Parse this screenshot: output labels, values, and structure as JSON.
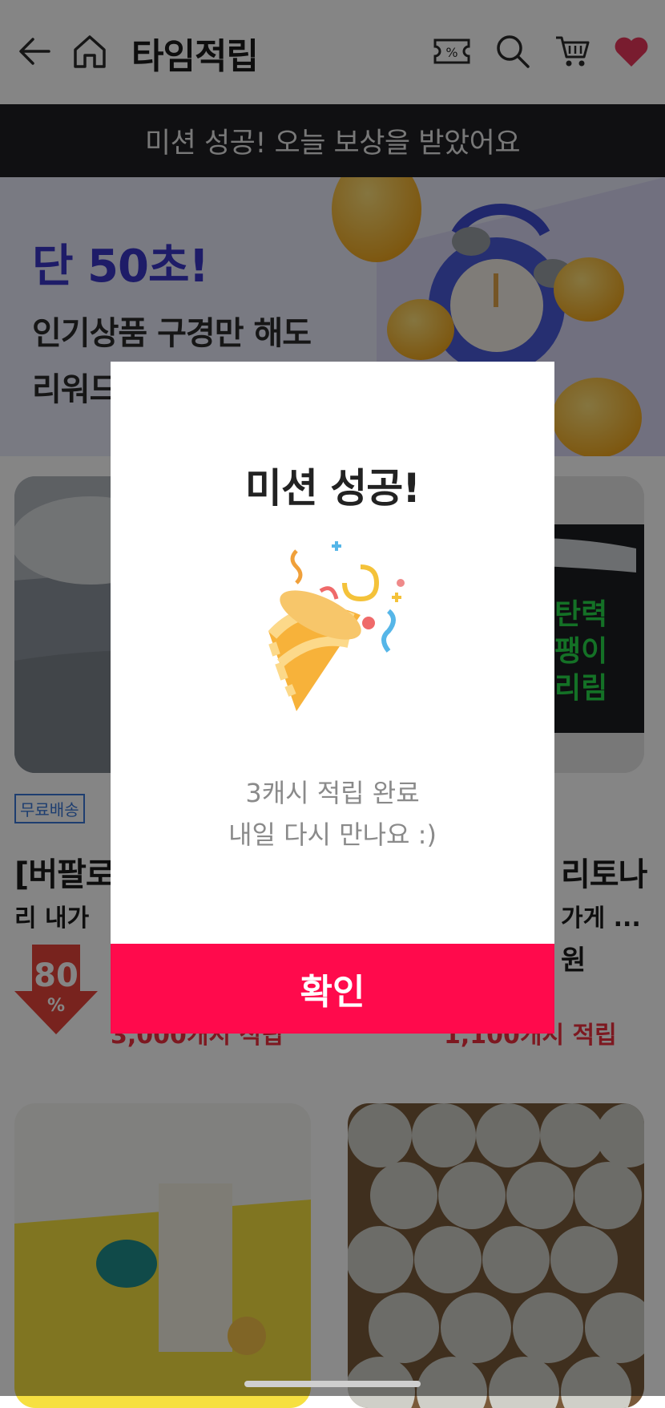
{
  "header": {
    "title": "타임적립",
    "icons": [
      "back-arrow-icon",
      "home-icon",
      "coupon-percent-icon",
      "search-icon",
      "cart-icon",
      "heart-icon"
    ],
    "coupon_symbol": "%"
  },
  "banner": {
    "text": "미션 성공! 오늘 보상을 받았어요"
  },
  "promo": {
    "headline": "단 50초!",
    "line1": "인기상품 구경만 해도",
    "line2": "리워드"
  },
  "products": {
    "left": {
      "badge": "무료배송",
      "name": "[버팔로",
      "name2": "리 내가",
      "discount": "80",
      "discount_unit": "%",
      "reward": "3,000캐시 적립"
    },
    "right": {
      "package_text": [
        "탄력",
        "팽이",
        "리림"
      ],
      "name": "리토나",
      "name2": "가게 ...",
      "price_suffix": "원",
      "reward": "1,100캐시 적립"
    }
  },
  "modal": {
    "title": "미션 성공!",
    "message_line1": "3캐시 적립 완료",
    "message_line2": "내일 다시 만나요 :)",
    "confirm_label": "확인"
  },
  "colors": {
    "accent": "#ff0a4c",
    "banner_bg": "#1f2023",
    "promo_headline": "#3a36c7",
    "heart": "#e8375a",
    "reward": "#ef2f3f"
  }
}
